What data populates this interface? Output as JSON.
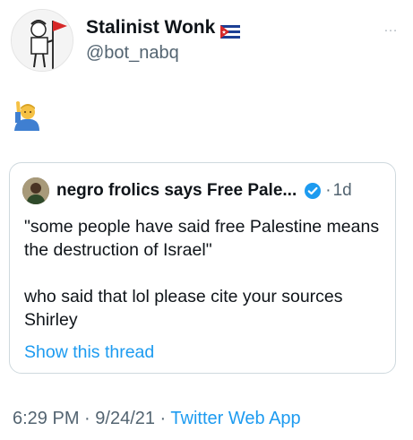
{
  "tweet": {
    "author": {
      "display_name": "Stalinist Wonk",
      "handle": "@bot_nabq",
      "flag_icon": "cuba-flag-icon"
    },
    "more_icon": "…",
    "body_emoji": "man-raising-hand-emoji"
  },
  "quote": {
    "author_name": "negro frolics says Free Pale...",
    "verified_icon": "verified-badge-icon",
    "separator": "·",
    "time": "1d",
    "paragraphs": [
      "\"some people have said free Palestine means the destruction of Israel\"",
      "who said that lol please cite your sources Shirley"
    ],
    "show_thread": "Show this thread"
  },
  "meta": {
    "time": "6:29 PM",
    "sep1": " · ",
    "date": "9/24/21",
    "sep2": " · ",
    "app": "Twitter Web App"
  },
  "colors": {
    "link": "#1d9bf0",
    "secondary_text": "#536471",
    "border": "#cfd9de"
  }
}
